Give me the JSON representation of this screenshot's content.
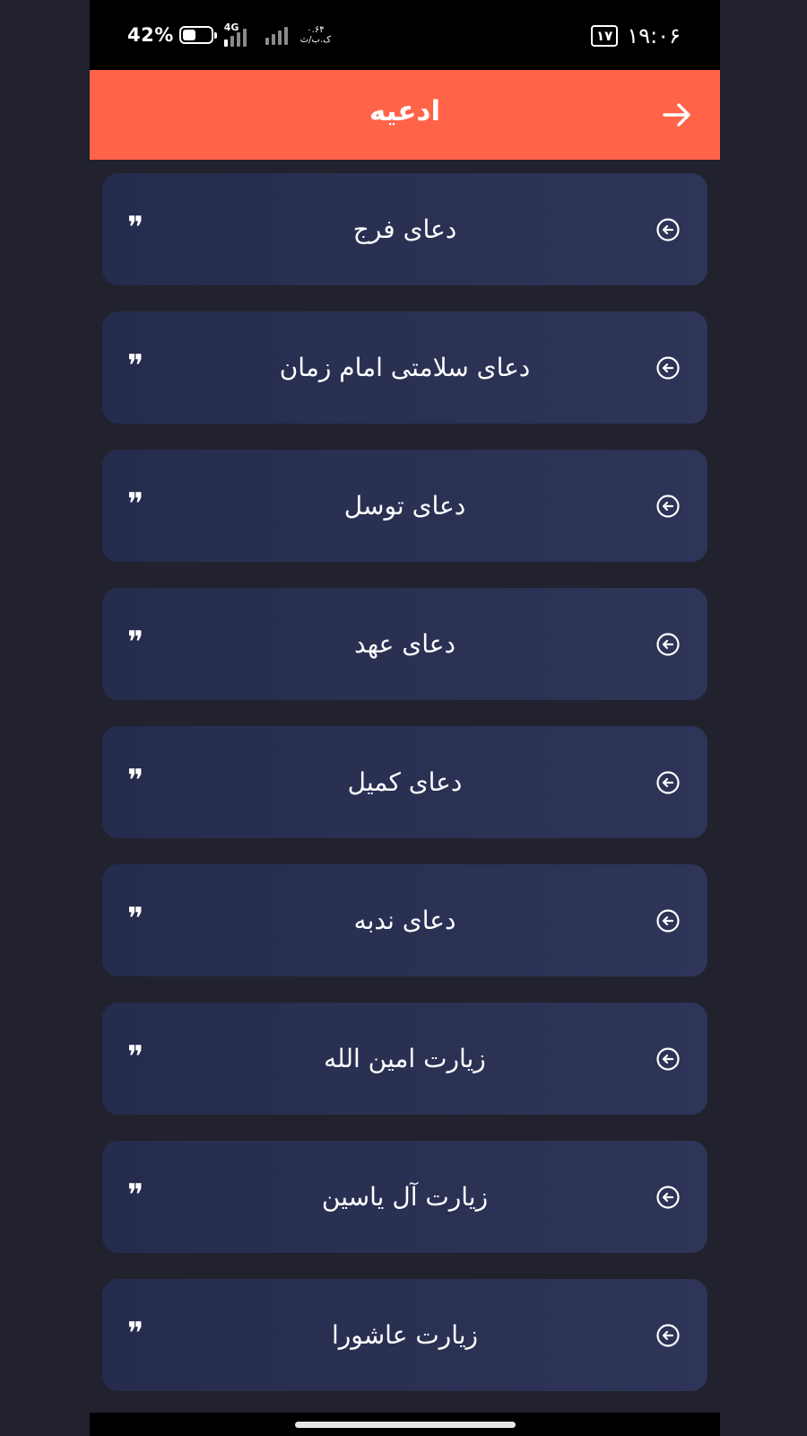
{
  "status_bar": {
    "battery_percent": "42%",
    "network_type": "4G",
    "speed_value": "۰.۶۴",
    "speed_unit": "ک.ب/ث",
    "date_badge": "۱۷",
    "time": "۱۹:۰۶"
  },
  "header": {
    "title": "ادعیه",
    "back_icon": "arrow-right-icon",
    "background_color": "#ff6448"
  },
  "items": [
    {
      "label": "دعای فرج"
    },
    {
      "label": "دعای سلامتی امام زمان"
    },
    {
      "label": "دعای توسل"
    },
    {
      "label": "دعای عهد"
    },
    {
      "label": "دعای کمیل"
    },
    {
      "label": "دعای ندبه"
    },
    {
      "label": "زیارت امین الله"
    },
    {
      "label": "زیارت آل یاسین"
    },
    {
      "label": "زیارت عاشورا"
    }
  ],
  "item_icons": {
    "open": "circle-arrow-left-icon",
    "quote": "quote-icon",
    "quote_glyph": "❞"
  },
  "colors": {
    "page_bg": "#21222d",
    "card_bg": "#2b3154",
    "accent": "#ff6448"
  }
}
